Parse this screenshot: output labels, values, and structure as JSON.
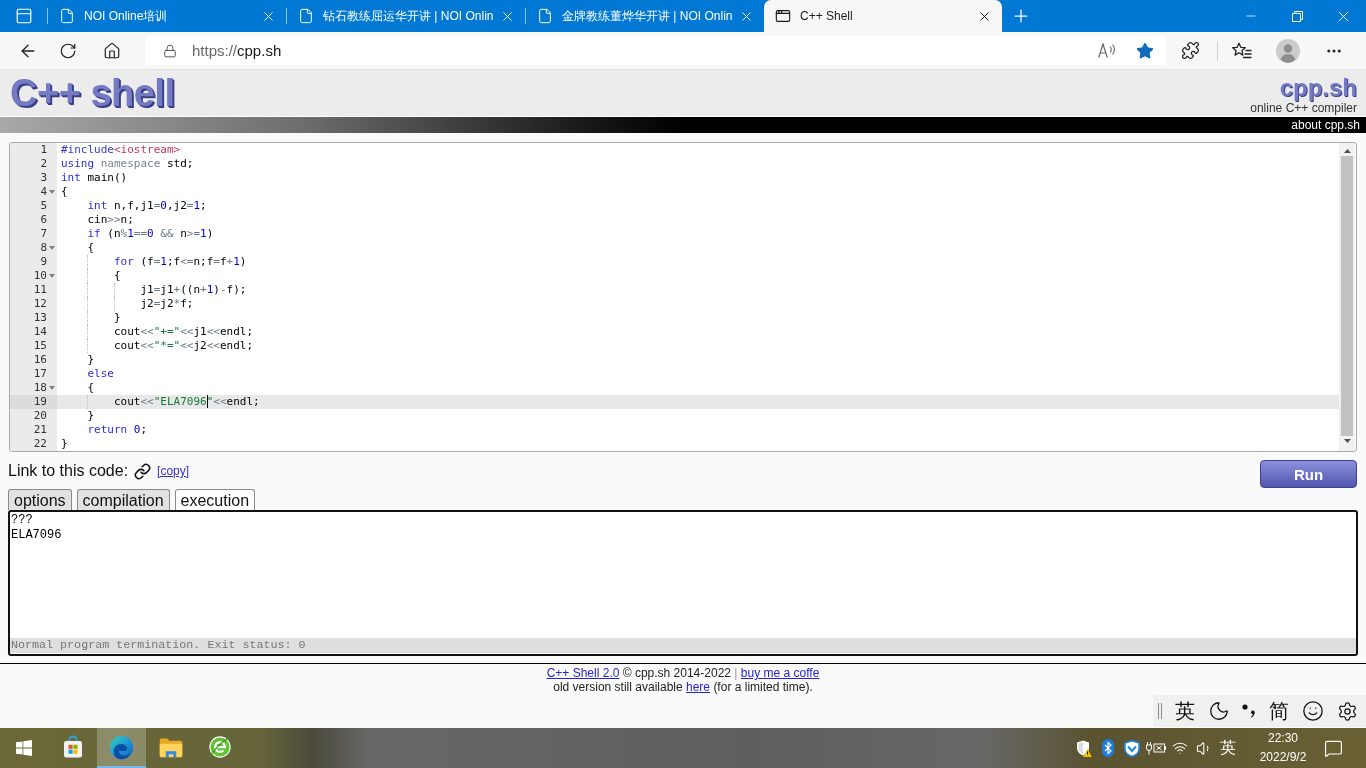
{
  "browser": {
    "tabs": [
      {
        "title": "NOI Online培训",
        "kind": "document",
        "selected": false
      },
      {
        "title": "钻石教练屈运华开讲 | NOI Onlin",
        "kind": "document",
        "selected": false
      },
      {
        "title": "金牌教练董烨华开讲 | NOI Onlin",
        "kind": "document",
        "selected": false
      },
      {
        "title": "C++ Shell",
        "kind": "app",
        "selected": true
      }
    ],
    "address_bar": {
      "scheme": "https://",
      "host": "cpp.sh",
      "favorite": true
    }
  },
  "header": {
    "logo": "C++ shell",
    "brand": "cpp.sh",
    "tagline": "online C++ compiler",
    "about_link": "about cpp.sh"
  },
  "editor": {
    "lines": [
      {
        "number": "1",
        "active": false,
        "tokens": [
          {
            "kind": "preproc",
            "text": "#include"
          },
          {
            "kind": "header",
            "text": "<iostream>"
          }
        ]
      },
      {
        "number": "2",
        "active": false,
        "tokens": [
          {
            "kind": "keyword",
            "text": "using "
          },
          {
            "kind": "dim",
            "text": "namespace "
          },
          {
            "kind": "text",
            "text": "std;"
          }
        ]
      },
      {
        "number": "3",
        "active": false,
        "tokens": [
          {
            "kind": "keyword",
            "text": "int "
          },
          {
            "kind": "text",
            "text": "main()"
          }
        ]
      },
      {
        "number": "4",
        "active": false,
        "tokens": [
          {
            "kind": "text",
            "text": "{"
          }
        ],
        "children": [
          {
            "number": "5",
            "active": false,
            "tokens": [
              {
                "kind": "keyword",
                "text": "int "
              },
              {
                "kind": "text",
                "text": "n,f,j1"
              },
              {
                "kind": "op",
                "text": "="
              },
              {
                "kind": "number",
                "text": "0"
              },
              {
                "kind": "text",
                "text": ",j2"
              },
              {
                "kind": "op",
                "text": "="
              },
              {
                "kind": "number",
                "text": "1"
              },
              {
                "kind": "text",
                "text": ";"
              }
            ]
          },
          {
            "number": "6",
            "active": false,
            "tokens": [
              {
                "kind": "text",
                "text": "cin"
              },
              {
                "kind": "op",
                "text": ">>"
              },
              {
                "kind": "text",
                "text": "n;"
              }
            ]
          },
          {
            "number": "7",
            "active": false,
            "tokens": [
              {
                "kind": "keyword",
                "text": "if "
              },
              {
                "kind": "text",
                "text": "(n"
              },
              {
                "kind": "op",
                "text": "%"
              },
              {
                "kind": "number",
                "text": "1"
              },
              {
                "kind": "op",
                "text": "=="
              },
              {
                "kind": "number",
                "text": "0"
              },
              {
                "kind": "op",
                "text": " && "
              },
              {
                "kind": "text",
                "text": "n"
              },
              {
                "kind": "op",
                "text": ">="
              },
              {
                "kind": "number",
                "text": "1"
              },
              {
                "kind": "text",
                "text": ")"
              }
            ]
          },
          {
            "number": "8",
            "active": false,
            "tokens": [
              {
                "kind": "text",
                "text": "{"
              }
            ],
            "children": [
              {
                "number": "9",
                "active": false,
                "tokens": [
                  {
                    "kind": "keyword",
                    "text": "for "
                  },
                  {
                    "kind": "text",
                    "text": "(f"
                  },
                  {
                    "kind": "op",
                    "text": "="
                  },
                  {
                    "kind": "number",
                    "text": "1"
                  },
                  {
                    "kind": "text",
                    "text": ";f"
                  },
                  {
                    "kind": "op",
                    "text": "<="
                  },
                  {
                    "kind": "text",
                    "text": "n;f"
                  },
                  {
                    "kind": "op",
                    "text": "="
                  },
                  {
                    "kind": "text",
                    "text": "f"
                  },
                  {
                    "kind": "op",
                    "text": "+"
                  },
                  {
                    "kind": "number",
                    "text": "1"
                  },
                  {
                    "kind": "text",
                    "text": ")"
                  }
                ]
              },
              {
                "number": "10",
                "active": false,
                "tokens": [
                  {
                    "kind": "text",
                    "text": "{"
                  }
                ],
                "children": [
                  {
                    "number": "11",
                    "active": false,
                    "tokens": [
                      {
                        "kind": "text",
                        "text": "j1"
                      },
                      {
                        "kind": "op",
                        "text": "="
                      },
                      {
                        "kind": "text",
                        "text": "j1"
                      },
                      {
                        "kind": "op",
                        "text": "+"
                      },
                      {
                        "kind": "text",
                        "text": "((n"
                      },
                      {
                        "kind": "op",
                        "text": "+"
                      },
                      {
                        "kind": "number",
                        "text": "1"
                      },
                      {
                        "kind": "text",
                        "text": ")"
                      },
                      {
                        "kind": "op",
                        "text": "-"
                      },
                      {
                        "kind": "text",
                        "text": "f);"
                      }
                    ]
                  },
                  {
                    "number": "12",
                    "active": false,
                    "tokens": [
                      {
                        "kind": "text",
                        "text": "j2"
                      },
                      {
                        "kind": "op",
                        "text": "="
                      },
                      {
                        "kind": "text",
                        "text": "j2"
                      },
                      {
                        "kind": "op",
                        "text": "*"
                      },
                      {
                        "kind": "text",
                        "text": "f;"
                      }
                    ]
                  }
                ]
              },
              {
                "number": "13",
                "active": false,
                "tokens": [
                  {
                    "kind": "text",
                    "text": "}"
                  }
                ]
              },
              {
                "number": "14",
                "active": false,
                "tokens": [
                  {
                    "kind": "text",
                    "text": "cout"
                  },
                  {
                    "kind": "op",
                    "text": "<<"
                  },
                  {
                    "kind": "string",
                    "text": "\"+=\""
                  },
                  {
                    "kind": "op",
                    "text": "<<"
                  },
                  {
                    "kind": "text",
                    "text": "j1"
                  },
                  {
                    "kind": "op",
                    "text": "<<"
                  },
                  {
                    "kind": "text",
                    "text": "endl;"
                  }
                ]
              },
              {
                "number": "15",
                "active": false,
                "tokens": [
                  {
                    "kind": "text",
                    "text": "cout"
                  },
                  {
                    "kind": "op",
                    "text": "<<"
                  },
                  {
                    "kind": "string",
                    "text": "\"*=\""
                  },
                  {
                    "kind": "op",
                    "text": "<<"
                  },
                  {
                    "kind": "text",
                    "text": "j2"
                  },
                  {
                    "kind": "op",
                    "text": "<<"
                  },
                  {
                    "kind": "text",
                    "text": "endl;"
                  }
                ]
              }
            ]
          },
          {
            "number": "16",
            "active": false,
            "tokens": [
              {
                "kind": "text",
                "text": "}"
              }
            ]
          },
          {
            "number": "17",
            "active": false,
            "tokens": [
              {
                "kind": "keyword",
                "text": "else"
              }
            ]
          },
          {
            "number": "18",
            "active": false,
            "tokens": [
              {
                "kind": "text",
                "text": "{"
              }
            ],
            "children": [
              {
                "number": "19",
                "active": true,
                "tokens": [
                  {
                    "kind": "text",
                    "text": "cout"
                  },
                  {
                    "kind": "op",
                    "text": "<<"
                  },
                  {
                    "kind": "string",
                    "text": "\"ELA7096",
                    "cursor": true
                  },
                  {
                    "kind": "string",
                    "text": "\""
                  },
                  {
                    "kind": "op",
                    "text": "<<"
                  },
                  {
                    "kind": "text",
                    "text": "endl;"
                  }
                ]
              }
            ]
          },
          {
            "number": "20",
            "active": false,
            "tokens": [
              {
                "kind": "text",
                "text": "}"
              }
            ]
          },
          {
            "number": "21",
            "active": false,
            "tokens": [
              {
                "kind": "keyword",
                "text": "return "
              },
              {
                "kind": "number",
                "text": "0"
              },
              {
                "kind": "text",
                "text": ";"
              }
            ]
          }
        ]
      },
      {
        "number": "22",
        "active": false,
        "tokens": [
          {
            "kind": "text",
            "text": "}"
          }
        ]
      }
    ]
  },
  "link_row": {
    "label": "Link to this code:",
    "copy_link": "[copy]"
  },
  "run_button": "Run",
  "output_tabs": [
    {
      "label": "options",
      "selected": false
    },
    {
      "label": "compilation",
      "selected": false
    },
    {
      "label": "execution",
      "selected": true
    }
  ],
  "output": {
    "lines": [
      "???",
      "ELA7096"
    ],
    "status": "Normal program termination. Exit status: 0"
  },
  "footer": {
    "line_1": [
      {
        "kind": "link",
        "text": "C++ Shell 2.0"
      },
      {
        "kind": "text",
        "text": "© cpp.sh 2014-2022"
      },
      {
        "kind": "separator",
        "text": "|"
      },
      {
        "kind": "link",
        "text": "buy me a coffe"
      }
    ],
    "line_2": [
      {
        "kind": "text",
        "text": "old version still available"
      },
      {
        "kind": "link",
        "text": "here"
      },
      {
        "kind": "text",
        "text": "(for a limited time)."
      }
    ]
  },
  "ime_toolbar": {
    "language": "英",
    "script": "简"
  },
  "taskbar": {
    "apps": [
      {
        "kind": "store",
        "active": false
      },
      {
        "kind": "swirl",
        "active": true
      },
      {
        "kind": "folder",
        "active": false
      },
      {
        "kind": "globe",
        "active": false
      }
    ],
    "input_language": "英",
    "time": "22:30",
    "date": "2022/9/2"
  }
}
